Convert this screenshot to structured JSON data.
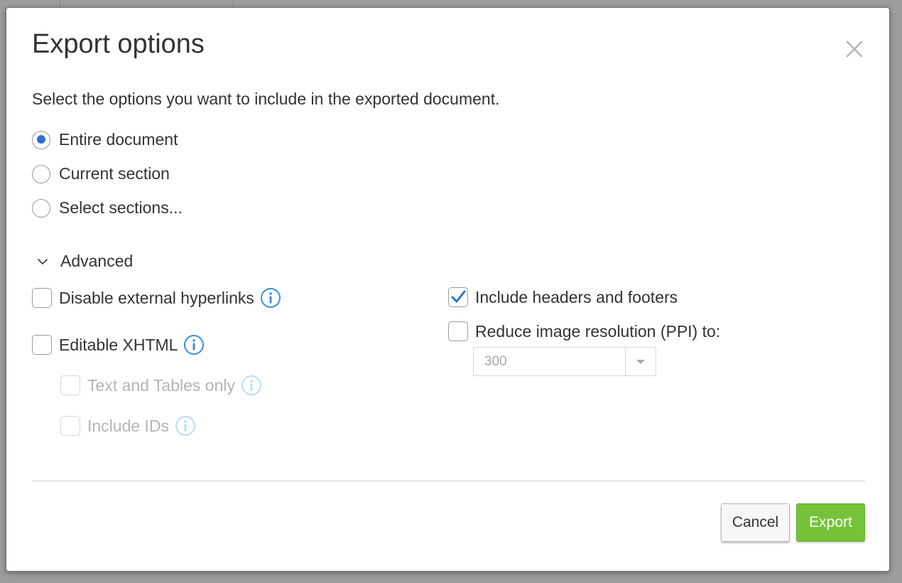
{
  "dialog": {
    "title": "Export options",
    "description": "Select the options you want to include in the exported document."
  },
  "scope": {
    "options": [
      {
        "label": "Entire document",
        "checked": true
      },
      {
        "label": "Current section",
        "checked": false
      },
      {
        "label": "Select sections...",
        "checked": false
      }
    ]
  },
  "advanced": {
    "label": "Advanced",
    "expanded": true,
    "disable_hyperlinks": {
      "label": "Disable external hyperlinks",
      "checked": false
    },
    "editable_xhtml": {
      "label": "Editable XHTML",
      "checked": false
    },
    "text_tables_only": {
      "label": "Text and Tables only",
      "checked": false,
      "disabled": true
    },
    "include_ids": {
      "label": "Include IDs",
      "checked": false,
      "disabled": true
    },
    "headers_footers": {
      "label": "Include headers and footers",
      "checked": true
    },
    "reduce_resolution": {
      "label": "Reduce image resolution (PPI) to:",
      "checked": false
    },
    "ppi_select": {
      "value": "300",
      "disabled": true
    }
  },
  "buttons": {
    "cancel": "Cancel",
    "export": "Export"
  },
  "colors": {
    "accent_blue": "#2f6fd1",
    "info_blue": "#3a8ee6",
    "export_green": "#76c33a"
  }
}
